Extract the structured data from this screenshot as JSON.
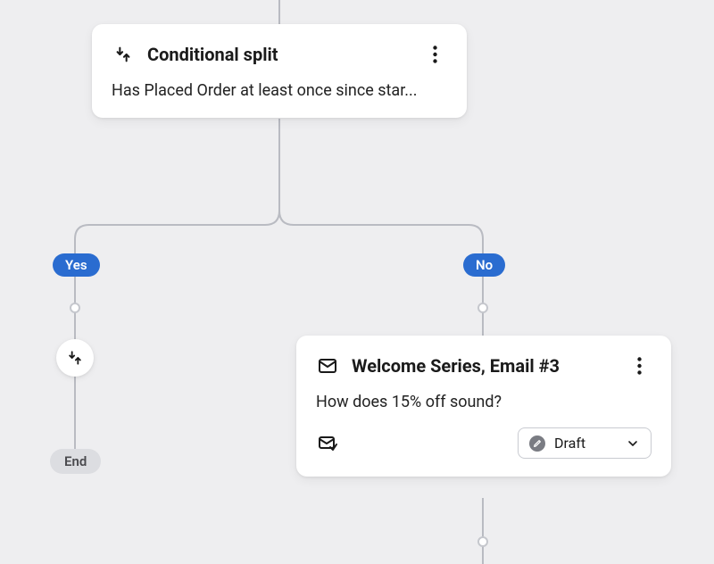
{
  "split_card": {
    "title": "Conditional split",
    "description": "Has Placed Order at least once since star..."
  },
  "branches": {
    "yes": {
      "label": "Yes",
      "end_label": "End"
    },
    "no": {
      "label": "No"
    }
  },
  "email_card": {
    "title": "Welcome Series, Email #3",
    "subject": "How does 15% off sound?",
    "status": "Draft"
  }
}
